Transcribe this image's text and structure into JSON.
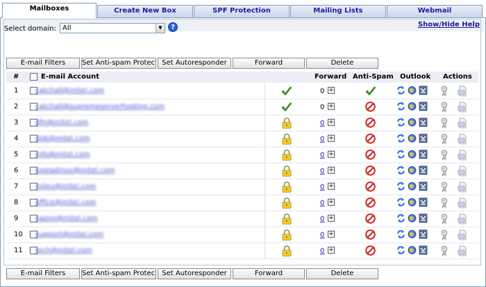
{
  "tabs": [
    "Mailboxes",
    "Create New Box",
    "SPF Protection",
    "Mailing Lists",
    "Webmail"
  ],
  "help_link": "Show/Hide Help",
  "domain": {
    "label": "Select domain:",
    "value": "All"
  },
  "buttons": {
    "email_filters": "E-mail Filters",
    "anti_spam": "Set Anti-spam Protection",
    "autoresponder": "Set Autoresponder",
    "forward": "Forward",
    "delete": "Delete"
  },
  "table": {
    "headers": {
      "num": "#",
      "account": "E-mail Account",
      "forward": "Forward",
      "antispam": "Anti-Spam",
      "outlook": "Outlook",
      "actions": "Actions"
    },
    "rows": [
      {
        "num": "1",
        "email": "catchall@mitel.com",
        "status": "check",
        "forward": "0",
        "forward_link": false,
        "antispam": "on"
      },
      {
        "num": "2",
        "email": "catchall@supremeserverhosting.com",
        "status": "check",
        "forward": "0",
        "forward_link": false,
        "antispam": "off"
      },
      {
        "num": "3",
        "email": "dfn@mitel.com",
        "status": "lock",
        "forward": "0",
        "forward_link": true,
        "antispam": "off"
      },
      {
        "num": "4",
        "email": "dob@mitel.com",
        "status": "lock",
        "forward": "0",
        "forward_link": true,
        "antispam": "off"
      },
      {
        "num": "5",
        "email": "info@mitel.com",
        "status": "lock",
        "forward": "0",
        "forward_link": true,
        "antispam": "off"
      },
      {
        "num": "6",
        "email": "kostadinov@mitel.com",
        "status": "lock",
        "forward": "0",
        "forward_link": true,
        "antispam": "off"
      },
      {
        "num": "7",
        "email": "milev@mitel.com",
        "status": "lock",
        "forward": "0",
        "forward_link": true,
        "antispam": "off"
      },
      {
        "num": "8",
        "email": "office@mitel.com",
        "status": "lock",
        "forward": "0",
        "forward_link": true,
        "antispam": "off"
      },
      {
        "num": "9",
        "email": "pazov@mitel.com",
        "status": "lock",
        "forward": "0",
        "forward_link": true,
        "antispam": "off"
      },
      {
        "num": "10",
        "email": "support@mitel.com",
        "status": "lock",
        "forward": "0",
        "forward_link": true,
        "antispam": "off"
      },
      {
        "num": "11",
        "email": "tech@mitel.com",
        "status": "lock",
        "forward": "0",
        "forward_link": true,
        "antispam": "off"
      }
    ]
  },
  "icons": {
    "help": "question-icon",
    "status_ok": "check-icon",
    "status_locked": "lock-icon",
    "antispam_on": "check-icon",
    "antispam_off": "prohibited-icon",
    "outlook": [
      "sync-icon",
      "globe-icon",
      "outlook-settings-icon"
    ],
    "actions": [
      "edit-pen-icon",
      "delete-document-icon"
    ]
  },
  "colors": {
    "tab_text": "#1a1aa6",
    "check_green": "#3aa31f",
    "stop_red": "#d02020",
    "lock_gold": "#e0b820",
    "link_blue": "#1a1ab0"
  }
}
